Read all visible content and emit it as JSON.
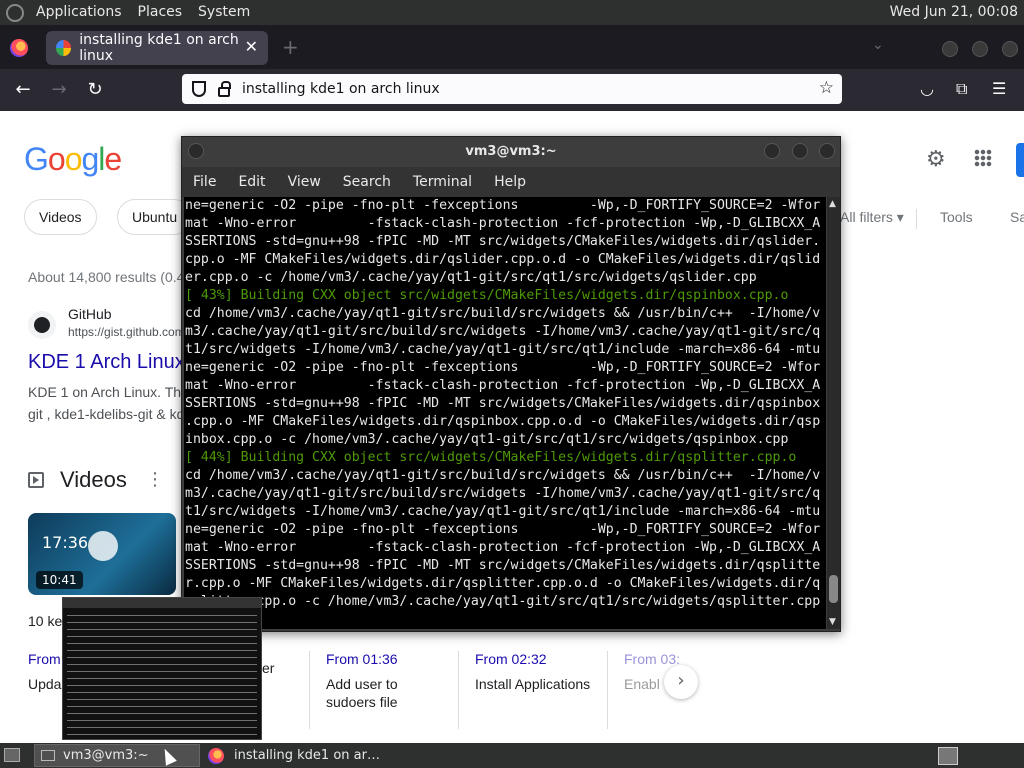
{
  "top_panel": {
    "menus": [
      "Applications",
      "Places",
      "System"
    ],
    "clock": "Wed Jun 21, 00:08"
  },
  "browser": {
    "tab_title": "installing kde1 on arch linux",
    "tab_close": "✕",
    "new_tab": "+",
    "url": "installing kde1 on arch linux"
  },
  "google": {
    "chips": [
      "Videos",
      "Ubuntu"
    ],
    "all_filters": "All filters",
    "tools": "Tools",
    "sa": "Sa",
    "results_count": "About 14,800 results (0.4",
    "result": {
      "site": "GitHub",
      "url": "https://gist.github.com",
      "title": "KDE 1 Arch Linux",
      "snippet_1": "KDE 1 on Arch Linux. Th",
      "snippet_2": "git , kde1-kdelibs-git & kd"
    },
    "videos_heading": "Videos",
    "video": {
      "thumb_time": "17:36",
      "duration": "10:41"
    },
    "key_moments": "10 ke",
    "moments": [
      {
        "from": "From",
        "desc": "Upda"
      },
      {
        "from": "",
        "desc": "er"
      },
      {
        "from": "From 01:36",
        "desc": "Add user to sudoers file"
      },
      {
        "from": "From 02:32",
        "desc": "Install Applications"
      },
      {
        "from": "From 03:",
        "desc": "Enabl"
      }
    ]
  },
  "terminal": {
    "title": "vm3@vm3:~",
    "menus": [
      "File",
      "Edit",
      "View",
      "Search",
      "Terminal",
      "Help"
    ],
    "lines": [
      {
        "t": "ne=generic -O2 -pipe -fno-plt -fexceptions         -Wp,-D_FORTIFY_SOURCE=2 -Wfor",
        "c": ""
      },
      {
        "t": "mat -Wno-error         -fstack-clash-protection -fcf-protection -Wp,-D_GLIBCXX_A",
        "c": ""
      },
      {
        "t": "SSERTIONS -std=gnu++98 -fPIC -MD -MT src/widgets/CMakeFiles/widgets.dir/qslider.",
        "c": ""
      },
      {
        "t": "cpp.o -MF CMakeFiles/widgets.dir/qslider.cpp.o.d -o CMakeFiles/widgets.dir/qslid",
        "c": ""
      },
      {
        "t": "er.cpp.o -c /home/vm3/.cache/yay/qt1-git/src/qt1/src/widgets/qslider.cpp",
        "c": ""
      },
      {
        "t": "[ 43%] Building CXX object src/widgets/CMakeFiles/widgets.dir/qspinbox.cpp.o",
        "c": "g"
      },
      {
        "t": "cd /home/vm3/.cache/yay/qt1-git/src/build/src/widgets && /usr/bin/c++  -I/home/v",
        "c": ""
      },
      {
        "t": "m3/.cache/yay/qt1-git/src/build/src/widgets -I/home/vm3/.cache/yay/qt1-git/src/q",
        "c": ""
      },
      {
        "t": "t1/src/widgets -I/home/vm3/.cache/yay/qt1-git/src/qt1/include -march=x86-64 -mtu",
        "c": ""
      },
      {
        "t": "ne=generic -O2 -pipe -fno-plt -fexceptions         -Wp,-D_FORTIFY_SOURCE=2 -Wfor",
        "c": ""
      },
      {
        "t": "mat -Wno-error         -fstack-clash-protection -fcf-protection -Wp,-D_GLIBCXX_A",
        "c": ""
      },
      {
        "t": "SSERTIONS -std=gnu++98 -fPIC -MD -MT src/widgets/CMakeFiles/widgets.dir/qspinbox",
        "c": ""
      },
      {
        "t": ".cpp.o -MF CMakeFiles/widgets.dir/qspinbox.cpp.o.d -o CMakeFiles/widgets.dir/qsp",
        "c": ""
      },
      {
        "t": "inbox.cpp.o -c /home/vm3/.cache/yay/qt1-git/src/qt1/src/widgets/qspinbox.cpp",
        "c": ""
      },
      {
        "t": "[ 44%] Building CXX object src/widgets/CMakeFiles/widgets.dir/qsplitter.cpp.o",
        "c": "g"
      },
      {
        "t": "cd /home/vm3/.cache/yay/qt1-git/src/build/src/widgets && /usr/bin/c++  -I/home/v",
        "c": ""
      },
      {
        "t": "m3/.cache/yay/qt1-git/src/build/src/widgets -I/home/vm3/.cache/yay/qt1-git/src/q",
        "c": ""
      },
      {
        "t": "t1/src/widgets -I/home/vm3/.cache/yay/qt1-git/src/qt1/include -march=x86-64 -mtu",
        "c": ""
      },
      {
        "t": "ne=generic -O2 -pipe -fno-plt -fexceptions         -Wp,-D_FORTIFY_SOURCE=2 -Wfor",
        "c": ""
      },
      {
        "t": "mat -Wno-error         -fstack-clash-protection -fcf-protection -Wp,-D_GLIBCXX_A",
        "c": ""
      },
      {
        "t": "SSERTIONS -std=gnu++98 -fPIC -MD -MT src/widgets/CMakeFiles/widgets.dir/qsplitte",
        "c": ""
      },
      {
        "t": "r.cpp.o -MF CMakeFiles/widgets.dir/qsplitter.cpp.o.d -o CMakeFiles/widgets.dir/q",
        "c": ""
      },
      {
        "t": "splitter.cpp.o -c /home/vm3/.cache/yay/qt1-git/src/qt1/src/widgets/qsplitter.cpp",
        "c": ""
      }
    ]
  },
  "taskbar": {
    "terminal": "vm3@vm3:~",
    "firefox": "installing kde1 on ar…"
  }
}
